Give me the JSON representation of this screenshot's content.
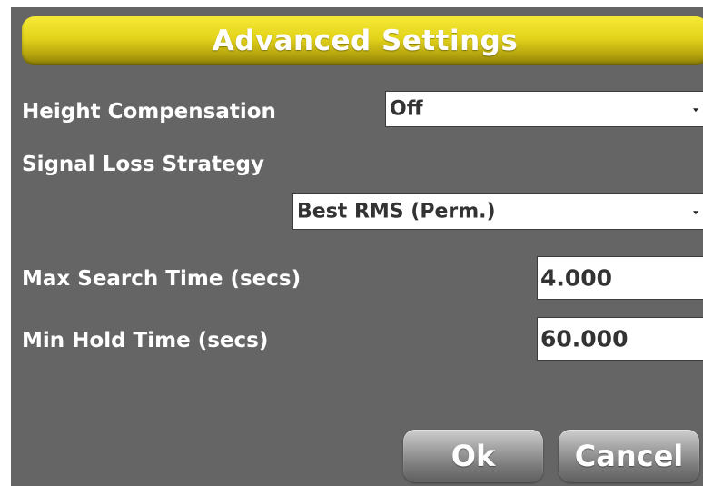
{
  "dialog": {
    "title": "Advanced Settings"
  },
  "height_compensation": {
    "label": "Height Compensation",
    "value": "Off"
  },
  "signal_loss_strategy": {
    "label": "Signal Loss Strategy",
    "value": "Best RMS (Perm.)"
  },
  "max_search_time": {
    "label": "Max Search Time (secs)",
    "value": "4.000"
  },
  "min_hold_time": {
    "label": "Min Hold Time (secs)",
    "value": "60.000"
  },
  "buttons": {
    "ok_label": "Ok",
    "cancel_label": "Cancel"
  },
  "colors": {
    "dialog_background": "#656565",
    "title_bar_yellow": "#e3d31a",
    "text_white": "#ffffff"
  },
  "icons": {
    "dropdown_arrow": "chevron-down-icon"
  }
}
